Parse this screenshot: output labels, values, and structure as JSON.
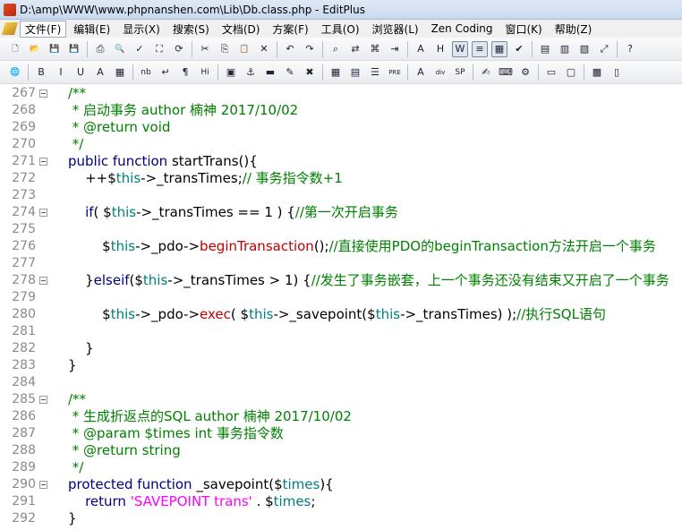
{
  "window": {
    "title": "D:\\amp\\WWW\\www.phpnanshen.com\\Lib\\Db.class.php - EditPlus"
  },
  "menu": [
    "文件(F)",
    "编辑(E)",
    "显示(X)",
    "搜索(S)",
    "文档(D)",
    "方案(F)",
    "工具(O)",
    "浏览器(L)",
    "Zen Coding",
    "窗口(K)",
    "帮助(Z)"
  ],
  "toolbar1": [
    {
      "name": "new-file-icon",
      "glyph": "🗋"
    },
    {
      "name": "open-file-icon",
      "glyph": "📂"
    },
    {
      "name": "save-icon",
      "glyph": "💾"
    },
    {
      "name": "save-all-icon",
      "glyph": "💾"
    },
    {
      "sep": true
    },
    {
      "name": "print-icon",
      "glyph": "⎙"
    },
    {
      "name": "print-preview-icon",
      "glyph": "🔍"
    },
    {
      "name": "spell-check-icon",
      "glyph": "✓"
    },
    {
      "name": "browser-preview-icon",
      "glyph": "⛶"
    },
    {
      "name": "refresh-icon",
      "glyph": "⟳"
    },
    {
      "sep": true
    },
    {
      "name": "cut-icon",
      "glyph": "✂"
    },
    {
      "name": "copy-icon",
      "glyph": "⎘"
    },
    {
      "name": "paste-icon",
      "glyph": "📋"
    },
    {
      "name": "delete-icon",
      "glyph": "✕"
    },
    {
      "sep": true
    },
    {
      "name": "undo-icon",
      "glyph": "↶"
    },
    {
      "name": "redo-icon",
      "glyph": "↷"
    },
    {
      "sep": true
    },
    {
      "name": "find-icon",
      "glyph": "⌕"
    },
    {
      "name": "replace-icon",
      "glyph": "⇄"
    },
    {
      "name": "find-in-files-icon",
      "glyph": "⌘"
    },
    {
      "name": "goto-icon",
      "glyph": "⇥"
    },
    {
      "sep": true
    },
    {
      "name": "font-size-icon",
      "glyph": "A"
    },
    {
      "name": "hex-view-icon",
      "glyph": "H"
    },
    {
      "name": "word-wrap-icon",
      "glyph": "W",
      "pressed": true
    },
    {
      "name": "line-number-icon",
      "glyph": "≡",
      "pressed": true
    },
    {
      "name": "column-ruler-icon",
      "glyph": "▦",
      "pressed": true
    },
    {
      "name": "check-icon",
      "glyph": "✔"
    },
    {
      "sep": true
    },
    {
      "name": "directory-window-icon",
      "glyph": "▤"
    },
    {
      "name": "clipboard-window-icon",
      "glyph": "▥"
    },
    {
      "name": "output-window-icon",
      "glyph": "▧"
    },
    {
      "name": "fullscreen-icon",
      "glyph": "⤢"
    },
    {
      "sep": true
    },
    {
      "name": "help-cursor-icon",
      "glyph": "?"
    }
  ],
  "toolbar2": [
    {
      "name": "browser-icon",
      "glyph": "🌐"
    },
    {
      "sep": true
    },
    {
      "name": "bold-icon",
      "glyph": "B"
    },
    {
      "name": "italic-icon",
      "glyph": "I"
    },
    {
      "name": "underline-icon",
      "glyph": "U"
    },
    {
      "name": "font-color-icon",
      "glyph": "A"
    },
    {
      "name": "color-grid-icon",
      "glyph": "▦"
    },
    {
      "sep": true
    },
    {
      "name": "nbsp-icon",
      "glyph": "nb"
    },
    {
      "name": "line-break-icon",
      "glyph": "↵"
    },
    {
      "name": "paragraph-icon",
      "glyph": "¶"
    },
    {
      "name": "heading-icon",
      "glyph": "Hi"
    },
    {
      "sep": true
    },
    {
      "name": "image-icon",
      "glyph": "▣"
    },
    {
      "name": "anchor-icon",
      "glyph": "⚓"
    },
    {
      "name": "horizontal-rule-icon",
      "glyph": "▬"
    },
    {
      "name": "highlight-icon",
      "glyph": "✎"
    },
    {
      "name": "comment-icon",
      "glyph": "✖"
    },
    {
      "sep": true
    },
    {
      "name": "table-icon",
      "glyph": "▦"
    },
    {
      "name": "form-icon",
      "glyph": "▤"
    },
    {
      "name": "align-icon",
      "glyph": "☰"
    },
    {
      "name": "pre-icon",
      "glyph": "PRE"
    },
    {
      "sep": true
    },
    {
      "name": "span-icon",
      "glyph": "A"
    },
    {
      "name": "div-icon",
      "glyph": "div"
    },
    {
      "name": "sp-icon",
      "glyph": "SP"
    },
    {
      "sep": true
    },
    {
      "name": "edit-icon",
      "glyph": "✍"
    },
    {
      "name": "script-icon",
      "glyph": "⌨"
    },
    {
      "name": "css-icon",
      "glyph": "⚙"
    },
    {
      "sep": true
    },
    {
      "name": "frame-icon",
      "glyph": "▭"
    },
    {
      "name": "layout-icon",
      "glyph": "▢"
    },
    {
      "sep": true
    },
    {
      "name": "color-picker-icon",
      "glyph": "▩"
    },
    {
      "name": "window-icon",
      "glyph": "▯"
    }
  ],
  "colors": {
    "comment": "#008000",
    "keyword": "#000080",
    "variable": "#008080",
    "function": "#c00000",
    "string": "#ff00ff"
  },
  "lines": [
    {
      "n": "267",
      "fold": true,
      "segs": [
        [
          "cm",
          "/**"
        ]
      ]
    },
    {
      "n": "268",
      "segs": [
        [
          "cm",
          " * 启动事务 author 楠神 2017/10/02"
        ]
      ]
    },
    {
      "n": "269",
      "segs": [
        [
          "cm",
          " * @return void"
        ]
      ]
    },
    {
      "n": "270",
      "segs": [
        [
          "cm",
          " */"
        ]
      ]
    },
    {
      "n": "271",
      "fold": true,
      "segs": [
        [
          "kw",
          "public function "
        ],
        [
          "",
          "startTrans(){"
        ]
      ]
    },
    {
      "n": "272",
      "segs": [
        [
          "",
          "    ++"
        ],
        [
          "",
          "$"
        ],
        [
          "var",
          "this"
        ],
        [
          "",
          "->_transTimes;"
        ],
        [
          "cm",
          "// 事务指令数+1"
        ]
      ]
    },
    {
      "n": "273",
      "segs": []
    },
    {
      "n": "274",
      "fold": true,
      "segs": [
        [
          "kw",
          "    if"
        ],
        [
          "",
          "( "
        ],
        [
          "",
          "$"
        ],
        [
          "var",
          "this"
        ],
        [
          "",
          "->_transTimes == 1 ) {"
        ],
        [
          "cm",
          "//第一次开启事务"
        ]
      ]
    },
    {
      "n": "275",
      "segs": []
    },
    {
      "n": "276",
      "segs": [
        [
          "",
          "        $"
        ],
        [
          "var",
          "this"
        ],
        [
          "",
          "->_pdo->"
        ],
        [
          "fn",
          "beginTransaction"
        ],
        [
          "",
          "();"
        ],
        [
          "cm",
          "//直接使用PDO的beginTransaction方法开启一个事务"
        ]
      ]
    },
    {
      "n": "277",
      "segs": []
    },
    {
      "n": "278",
      "fold": true,
      "segs": [
        [
          "",
          "    }"
        ],
        [
          "kw",
          "elseif"
        ],
        [
          "",
          "("
        ],
        [
          "",
          "$"
        ],
        [
          "var",
          "this"
        ],
        [
          "",
          "->_transTimes > 1) {"
        ],
        [
          "cm",
          "//发生了事务嵌套，上一个事务还没有结束又开启了一个事务"
        ]
      ]
    },
    {
      "n": "279",
      "segs": []
    },
    {
      "n": "280",
      "segs": [
        [
          "",
          "        $"
        ],
        [
          "var",
          "this"
        ],
        [
          "",
          "->_pdo->"
        ],
        [
          "fn",
          "exec"
        ],
        [
          "",
          "( "
        ],
        [
          "",
          "$"
        ],
        [
          "var",
          "this"
        ],
        [
          "",
          "->_savepoint("
        ],
        [
          "",
          "$"
        ],
        [
          "var",
          "this"
        ],
        [
          "",
          "->_transTimes) );"
        ],
        [
          "cm",
          "//执行SQL语句"
        ]
      ]
    },
    {
      "n": "281",
      "segs": []
    },
    {
      "n": "282",
      "segs": [
        [
          "",
          "    }"
        ]
      ]
    },
    {
      "n": "283",
      "segs": [
        [
          "",
          "}"
        ]
      ]
    },
    {
      "n": "284",
      "segs": []
    },
    {
      "n": "285",
      "fold": true,
      "segs": [
        [
          "cm",
          "/**"
        ]
      ]
    },
    {
      "n": "286",
      "segs": [
        [
          "cm",
          " * 生成折返点的SQL author 楠神 2017/10/02"
        ]
      ]
    },
    {
      "n": "287",
      "segs": [
        [
          "cm",
          " * @param $times int 事务指令数"
        ]
      ]
    },
    {
      "n": "288",
      "segs": [
        [
          "cm",
          " * @return string"
        ]
      ]
    },
    {
      "n": "289",
      "segs": [
        [
          "cm",
          " */"
        ]
      ]
    },
    {
      "n": "290",
      "fold": true,
      "segs": [
        [
          "kw",
          "protected function "
        ],
        [
          "",
          "_savepoint("
        ],
        [
          "",
          "$"
        ],
        [
          "var",
          "times"
        ],
        [
          "",
          "){"
        ]
      ]
    },
    {
      "n": "291",
      "segs": [
        [
          "kw",
          "    return "
        ],
        [
          "str",
          "'SAVEPOINT trans'"
        ],
        [
          "",
          " . "
        ],
        [
          "",
          "$"
        ],
        [
          "var",
          "times"
        ],
        [
          "",
          ";"
        ]
      ]
    },
    {
      "n": "292",
      "segs": [
        [
          "",
          "}"
        ]
      ]
    }
  ]
}
